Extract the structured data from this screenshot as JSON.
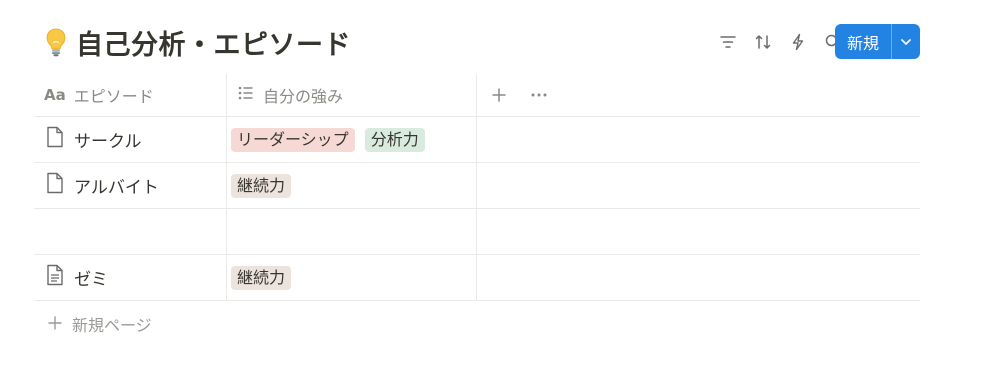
{
  "header": {
    "title": "自己分析・エピソード",
    "title_icon": "lightbulb-icon",
    "toolbar_icons": [
      "filter-icon",
      "sort-icon",
      "automation-icon",
      "search-icon",
      "expand-icon",
      "settings-icon"
    ],
    "new_label": "新規"
  },
  "columns": [
    {
      "label": "エピソード",
      "icon": "title-icon"
    },
    {
      "label": "自分の強み",
      "icon": "list-icon"
    }
  ],
  "rows": [
    {
      "name": "サークル",
      "icon": "page-icon",
      "tags": [
        {
          "label": "リーダーシップ",
          "color": "#f6d9d5"
        },
        {
          "label": "分析力",
          "color": "#d9eadf"
        }
      ]
    },
    {
      "name": "アルバイト",
      "icon": "page-icon",
      "tags": [
        {
          "label": "継続力",
          "color": "#ece3dc"
        }
      ]
    },
    {
      "name": "",
      "icon": "",
      "tags": []
    },
    {
      "name": "ゼミ",
      "icon": "page-text-icon",
      "tags": [
        {
          "label": "継続力",
          "color": "#ece3dc"
        }
      ]
    }
  ],
  "footer": {
    "new_page_label": "新規ページ"
  },
  "colors": {
    "accent": "#2383e2",
    "border": "#e9e9e7",
    "muted": "#9b9a97"
  }
}
